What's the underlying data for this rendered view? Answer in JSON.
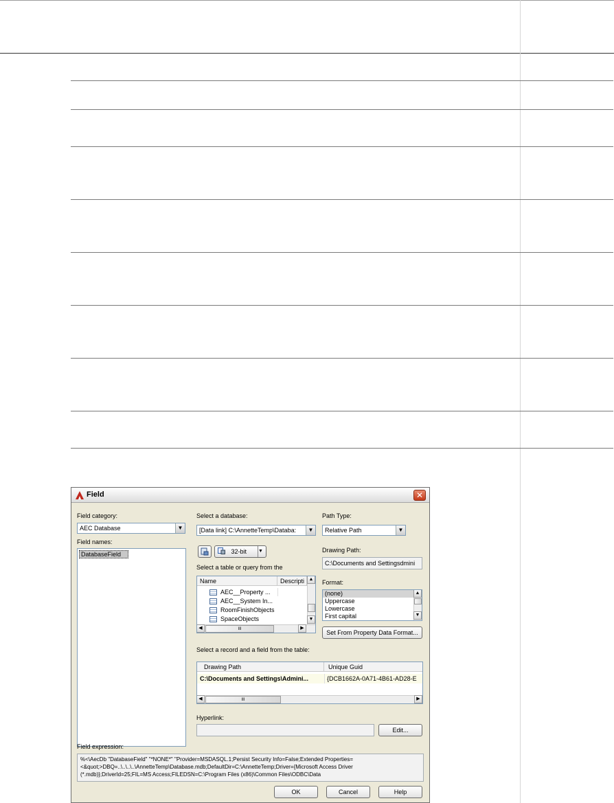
{
  "dialog": {
    "title": "Field",
    "close_label": "✕",
    "field_category": {
      "label": "Field category:",
      "value": "AEC Database"
    },
    "field_names": {
      "label": "Field names:",
      "items": [
        "DatabaseField"
      ]
    },
    "select_database": {
      "label": "Select a database:",
      "value": "[Data link] C:\\AnnetteTemp\\Databa:"
    },
    "path_type": {
      "label": "Path Type:",
      "value": "Relative Path"
    },
    "bitness": {
      "value": "32-bit"
    },
    "drawing_path": {
      "label": "Drawing Path:",
      "value": "C:\\Documents and Settingsdmini"
    },
    "table_query": {
      "label": "Select a table or query from the",
      "columns": [
        "Name",
        "Descripti"
      ],
      "rows": [
        "AEC__Property ...",
        "AEC__System In...",
        "RoomFinishObjects",
        "SpaceObjects"
      ],
      "hscroll_label": "III"
    },
    "format": {
      "label": "Format:",
      "items": [
        "(none)",
        "Uppercase",
        "Lowercase",
        "First capital"
      ],
      "selected": "(none)"
    },
    "set_from_property_label": "Set From Property Data Format...",
    "record_field": {
      "label": "Select a record and a field from the table:",
      "columns": [
        "Drawing Path",
        "Unique Guid"
      ],
      "row": [
        "C:\\Documents and Settings\\Admini...",
        "{DCB1662A-0A71-4B61-AD28-E"
      ],
      "hscroll_label": "III"
    },
    "hyperlink": {
      "label": "Hyperlink:",
      "value": "",
      "edit_label": "Edit..."
    },
    "field_expression": {
      "label": "Field expression:",
      "value": "%<\\AecDb \"DatabaseField\" \"*NONE*\" \"Provider=MSDASQL.1;Persist Security Info=False;Extended Properties=<&quot;>DBQ=..\\..\\..\\..\\AnnetteTemp\\Database.mdb;DefaultDir=C:\\AnnetteTemp;Driver={Microsoft Access Driver (*.mdb)};DriverId=25;FIL=MS Access;FILEDSN=C:\\Program Files (x86)\\Common Files\\ODBC\\Data"
    },
    "buttons": {
      "ok": "OK",
      "cancel": "Cancel",
      "help": "Help"
    }
  }
}
